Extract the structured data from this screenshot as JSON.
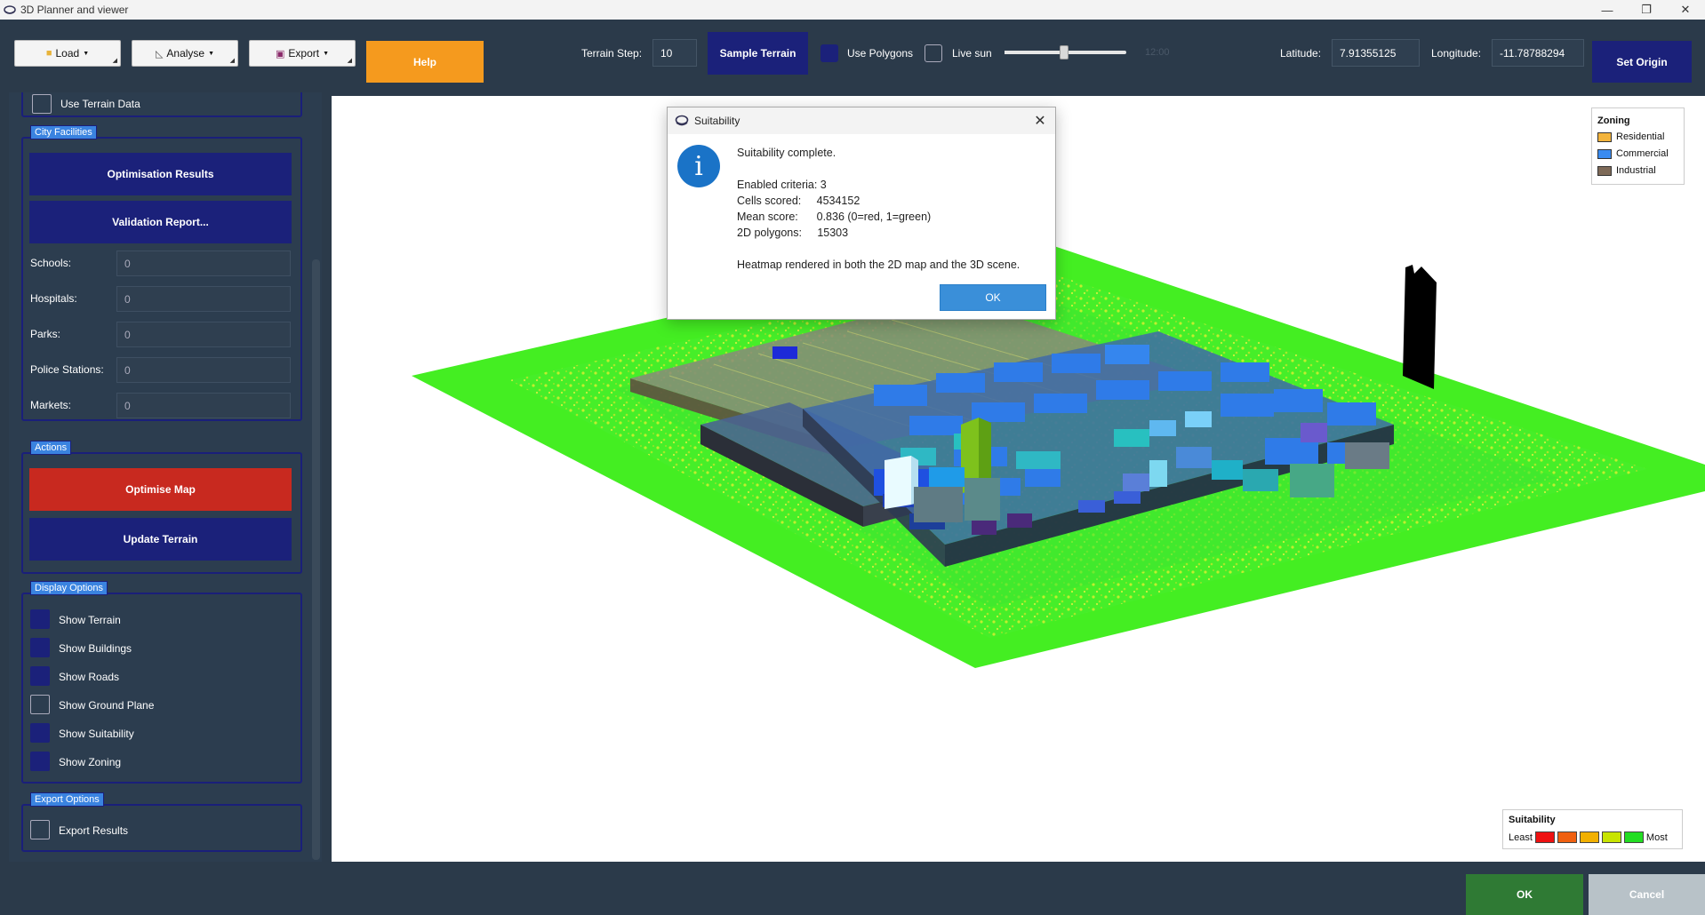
{
  "window": {
    "title": "3D Planner and viewer",
    "minimize": "—",
    "maximize": "❐",
    "close": "✕"
  },
  "toolbar": {
    "load": "Load",
    "analyse": "Analyse",
    "export": "Export",
    "help": "Help",
    "terrain_step_label": "Terrain Step:",
    "terrain_step_value": "10",
    "sample_terrain": "Sample Terrain",
    "use_polygons": "Use Polygons",
    "live_sun": "Live sun",
    "sun_time": "12:00",
    "latitude_label": "Latitude:",
    "latitude_value": "7.91355125",
    "longitude_label": "Longitude:",
    "longitude_value": "-11.78788294",
    "set_origin": "Set Origin"
  },
  "left_panel": {
    "partial_option": "Use Terrain Data",
    "city_facilities": {
      "title": "City Facilities",
      "optimisation_results": "Optimisation Results",
      "validation_report": "Validation Report...",
      "fields": [
        {
          "label": "Schools:",
          "value": "0"
        },
        {
          "label": "Hospitals:",
          "value": "0"
        },
        {
          "label": "Parks:",
          "value": "0"
        },
        {
          "label": "Police Stations:",
          "value": "0"
        },
        {
          "label": "Markets:",
          "value": "0"
        }
      ]
    },
    "actions": {
      "title": "Actions",
      "optimise_map": "Optimise Map",
      "update_terrain": "Update Terrain"
    },
    "display_options": {
      "title": "Display Options",
      "items": [
        {
          "label": "Show Terrain",
          "checked": true
        },
        {
          "label": "Show Buildings",
          "checked": true
        },
        {
          "label": "Show Roads",
          "checked": true
        },
        {
          "label": "Show Ground Plane",
          "checked": false
        },
        {
          "label": "Show Suitability",
          "checked": true
        },
        {
          "label": "Show Zoning",
          "checked": true
        }
      ]
    },
    "export_options": {
      "title": "Export Options",
      "export_results": "Export Results"
    }
  },
  "legend_zoning": {
    "title": "Zoning",
    "items": [
      {
        "label": "Residential",
        "color": "#f3b43c"
      },
      {
        "label": "Commercial",
        "color": "#3a8bf0"
      },
      {
        "label": "Industrial",
        "color": "#7e6a58"
      }
    ]
  },
  "legend_suitability": {
    "title": "Suitability",
    "least": "Least",
    "most": "Most",
    "colors": [
      "#ee1111",
      "#f06010",
      "#f2b000",
      "#c8e400",
      "#22dd22"
    ]
  },
  "dialog": {
    "title": "Suitability",
    "close": "✕",
    "heading": "Suitability complete.",
    "enabled_criteria": "Enabled criteria: 3",
    "cells_scored": "Cells scored:     4534152",
    "mean_score": "Mean score:      0.836 (0=red, 1=green)",
    "polygons": "2D polygons:     15303",
    "heatmap": "Heatmap rendered in both the 2D map and the 3D scene.",
    "ok": "OK",
    "info_glyph": "i"
  },
  "footer": {
    "ok": "OK",
    "cancel": "Cancel"
  },
  "colors": {
    "bg": "#2b3a4a",
    "navy": "#1b217a",
    "help": "#f59a1e",
    "danger": "#c8291f",
    "ok_green": "#2f7a34",
    "terrain_green": "#3ef03e"
  }
}
